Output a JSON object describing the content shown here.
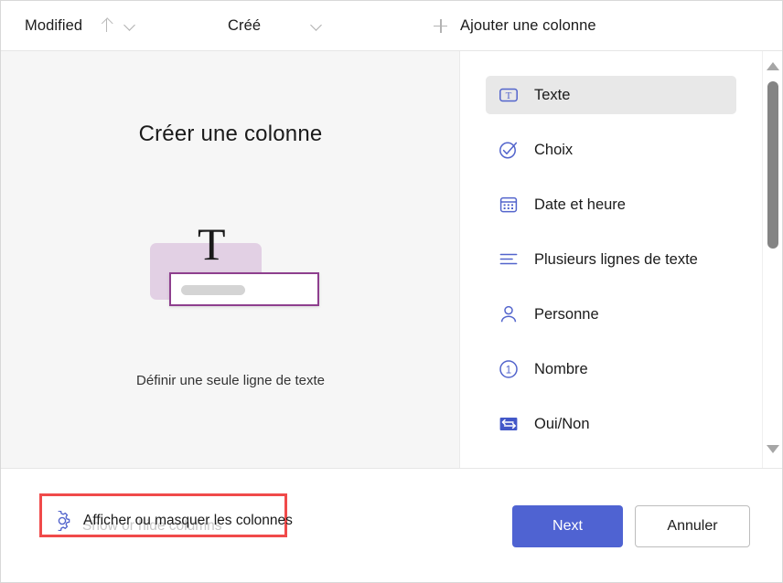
{
  "column_bar": {
    "columns": [
      {
        "label": "Modified",
        "icons": [
          "sort-ascending-icon",
          "chevron-down-icon"
        ]
      },
      {
        "label": "Créé",
        "icons": [
          "chevron-down-icon"
        ]
      }
    ],
    "add_column_label": "Ajouter une colonne",
    "add_column_icon": "plus-icon"
  },
  "preview": {
    "title": "Créer une colonne",
    "caption": "Définir une seule ligne de texte",
    "illustration_letter": "T",
    "colors": {
      "card": "#e2d0e4",
      "input_border": "#8e3f8e",
      "placeholder_pill": "#d4d4d4",
      "background": "#f6f6f6"
    }
  },
  "type_list": {
    "items": [
      {
        "label": "Texte",
        "icon": "text-box-icon",
        "selected": true
      },
      {
        "label": "Choix",
        "icon": "check-circle-icon",
        "selected": false
      },
      {
        "label": "Date et heure",
        "icon": "calendar-icon",
        "selected": false
      },
      {
        "label": "Plusieurs lignes de texte",
        "icon": "multiline-text-icon",
        "selected": false
      },
      {
        "label": "Personne",
        "icon": "person-icon",
        "selected": false
      },
      {
        "label": "Nombre",
        "icon": "number-one-circle-icon",
        "selected": false
      },
      {
        "label": "Oui/Non",
        "icon": "toggle-arrows-icon",
        "selected": false
      }
    ],
    "accent_color": "#5264cc",
    "selected_background": "#e8e8e8"
  },
  "scrollbar": {
    "up_arrow_icon": "triangle-up-icon",
    "down_arrow_icon": "triangle-down-icon",
    "thumb_color": "#848484"
  },
  "footer": {
    "show_hide": {
      "label": "Afficher ou masquer les colonnes",
      "ghost_label": "Show or hide columns",
      "icon": "gear-icon"
    },
    "next_label": "Next",
    "cancel_label": "Annuler",
    "next_color": "#4f63d2",
    "highlight_color": "#f04a4a"
  }
}
